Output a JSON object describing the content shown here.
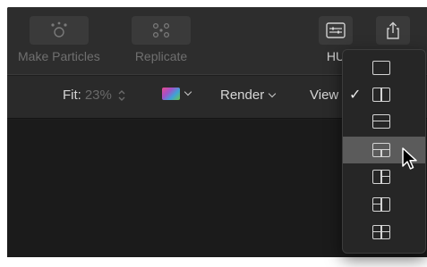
{
  "toolbar": {
    "tools": [
      {
        "label": "Make Particles",
        "icon": "particles-icon"
      },
      {
        "label": "Replicate",
        "icon": "replicate-icon"
      },
      {
        "label": "HU",
        "icon": "hud-icon"
      },
      {
        "label": "",
        "icon": "share-icon"
      }
    ]
  },
  "viewer": {
    "fit_label": "Fit:",
    "fit_value": "23%",
    "render_label": "Render",
    "view_label": "View"
  },
  "layout_menu": {
    "items": [
      {
        "icon": "single-view-icon",
        "checked": false,
        "highlighted": false
      },
      {
        "icon": "two-up-side-by-side-icon",
        "checked": true,
        "highlighted": false
      },
      {
        "icon": "two-up-stacked-icon",
        "checked": false,
        "highlighted": false
      },
      {
        "icon": "three-up-top-icon",
        "checked": false,
        "highlighted": true
      },
      {
        "icon": "three-up-left-icon",
        "checked": false,
        "highlighted": false
      },
      {
        "icon": "three-up-right-icon",
        "checked": false,
        "highlighted": false
      },
      {
        "icon": "four-up-icon",
        "checked": false,
        "highlighted": false
      }
    ],
    "check_glyph": "✓"
  }
}
